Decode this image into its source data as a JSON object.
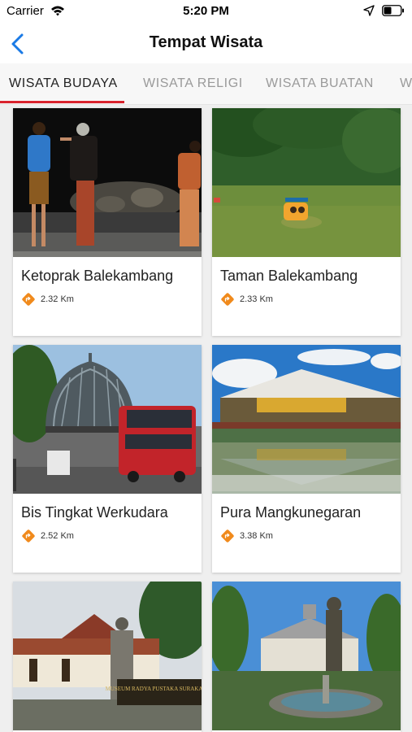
{
  "status": {
    "carrier": "Carrier",
    "time": "5:20 PM"
  },
  "header": {
    "title": "Tempat Wisata",
    "back_icon": "chevron-left-icon"
  },
  "tabs": [
    {
      "label": "WISATA BUDAYA",
      "active": true
    },
    {
      "label": "WISATA RELIGI",
      "active": false
    },
    {
      "label": "WISATA BUATAN",
      "active": false
    },
    {
      "label": "W",
      "active": false
    }
  ],
  "places": [
    {
      "name": "Ketoprak Balekambang",
      "distance": "2.32 Km"
    },
    {
      "name": "Taman Balekambang",
      "distance": "2.33 Km"
    },
    {
      "name": "Bis Tingkat Werkudara",
      "distance": "2.52 Km"
    },
    {
      "name": "Pura Mangkunegaran",
      "distance": "3.38 Km"
    },
    {
      "name": "",
      "distance": ""
    },
    {
      "name": "",
      "distance": ""
    }
  ],
  "photo_signs": {
    "museum": "MUSEUM RADYA PUSTAKA SURAKARTA"
  },
  "colors": {
    "accent": "#d9232d",
    "back": "#1a7ae6",
    "pin": "#f08a1c"
  }
}
